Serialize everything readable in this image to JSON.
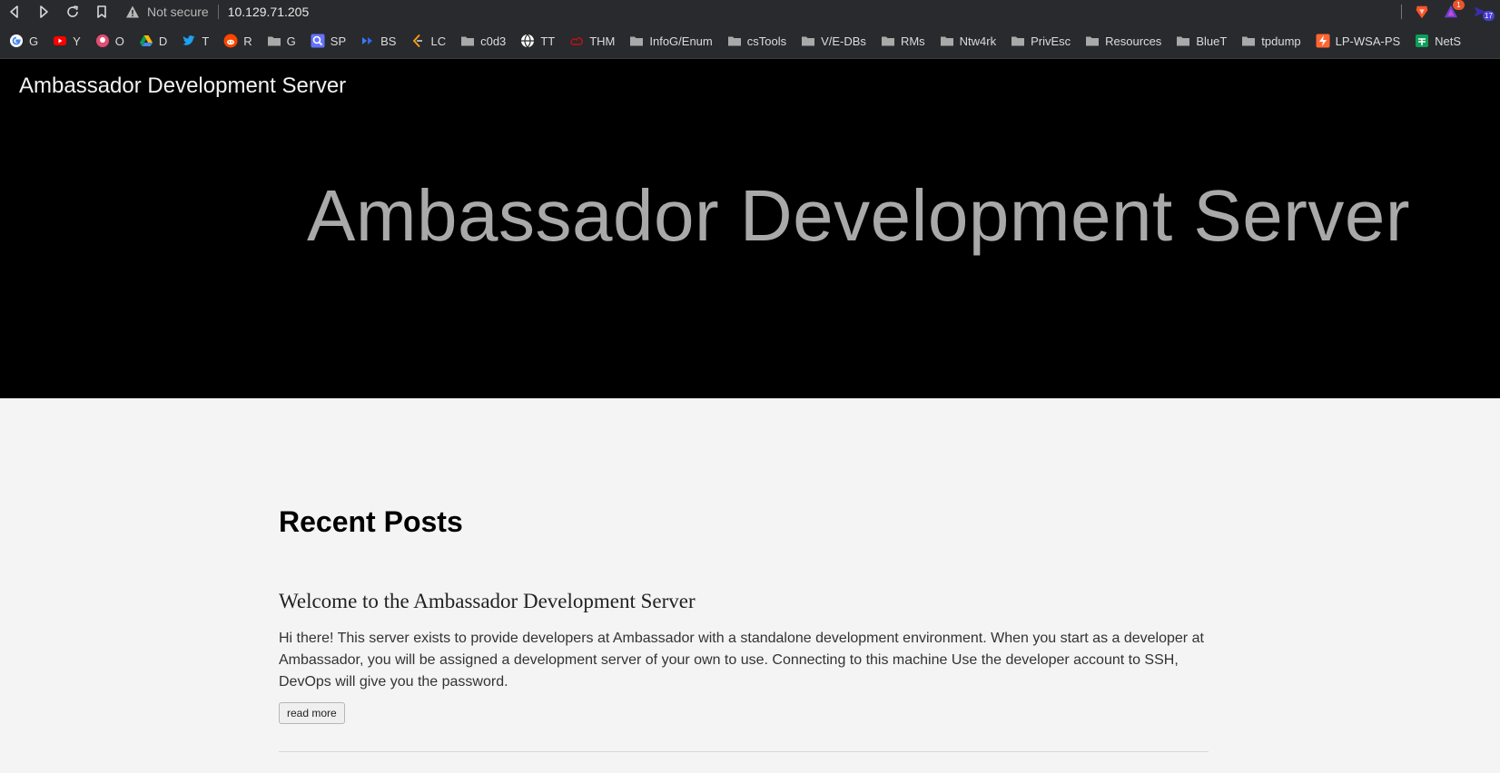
{
  "browser": {
    "security_label": "Not secure",
    "url": "10.129.71.205",
    "extensions": [
      {
        "icon": "brave-lion-icon",
        "badge": ""
      },
      {
        "icon": "brave-rewards-icon",
        "badge": "1"
      },
      {
        "icon": "brave-wallet-icon",
        "badge": "17"
      }
    ],
    "bookmarks": [
      {
        "icon": "google-icon",
        "label": "G"
      },
      {
        "icon": "youtube-icon",
        "label": "Y"
      },
      {
        "icon": "octopus-icon",
        "label": "O"
      },
      {
        "icon": "drive-icon",
        "label": "D"
      },
      {
        "icon": "twitter-icon",
        "label": "T"
      },
      {
        "icon": "reddit-icon",
        "label": "R"
      },
      {
        "icon": "folder-icon",
        "label": "G"
      },
      {
        "icon": "search-icon",
        "label": "SP"
      },
      {
        "icon": "bs-icon",
        "label": "BS"
      },
      {
        "icon": "lc-icon",
        "label": "LC"
      },
      {
        "icon": "folder-icon",
        "label": "c0d3"
      },
      {
        "icon": "globe-icon",
        "label": "TT"
      },
      {
        "icon": "thm-icon",
        "label": "THM"
      },
      {
        "icon": "folder-icon",
        "label": "InfoG/Enum"
      },
      {
        "icon": "folder-icon",
        "label": "csTools"
      },
      {
        "icon": "folder-icon",
        "label": "V/E-DBs"
      },
      {
        "icon": "folder-icon",
        "label": "RMs"
      },
      {
        "icon": "folder-icon",
        "label": "Ntw4rk"
      },
      {
        "icon": "folder-icon",
        "label": "PrivEsc"
      },
      {
        "icon": "folder-icon",
        "label": "Resources"
      },
      {
        "icon": "folder-icon",
        "label": "BlueT"
      },
      {
        "icon": "folder-icon",
        "label": "tpdump"
      },
      {
        "icon": "lightning-icon",
        "label": "LP-WSA-PS"
      },
      {
        "icon": "sheets-icon",
        "label": "NetS"
      }
    ]
  },
  "site": {
    "title": "Ambassador Development Server",
    "hero_title": "Ambassador Development Server"
  },
  "main": {
    "section_title": "Recent Posts",
    "posts": [
      {
        "title": "Welcome to the Ambassador Development Server",
        "body": "Hi there! This server exists to provide developers at Ambassador with a standalone development environment. When you start as a developer at Ambassador, you will be assigned a development server of your own to use. Connecting to this machine Use the developer account to SSH, DevOps will give you the password.",
        "read_more": "read more"
      }
    ]
  }
}
